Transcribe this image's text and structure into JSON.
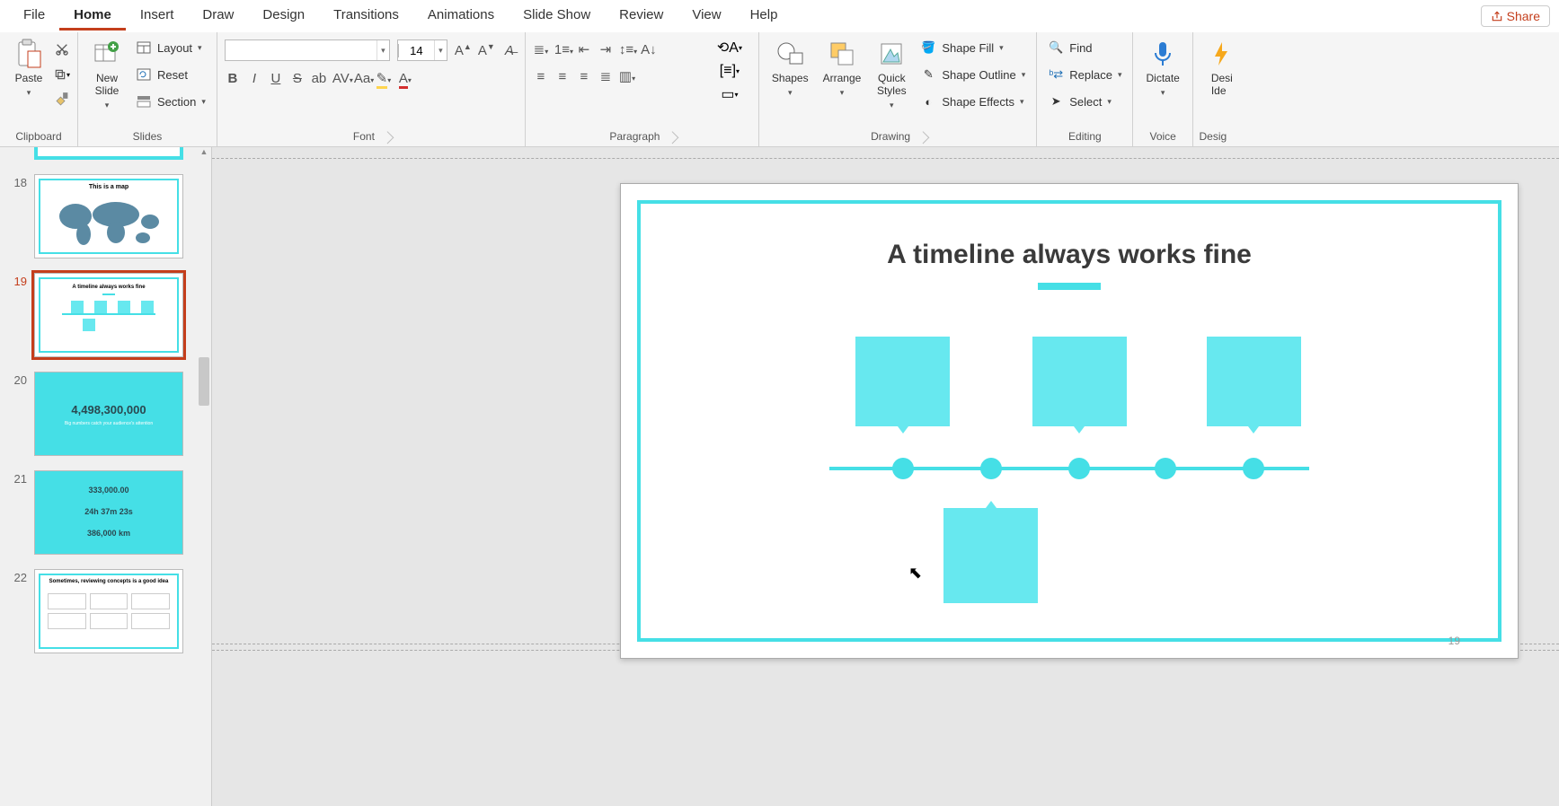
{
  "tabs": [
    "File",
    "Home",
    "Insert",
    "Draw",
    "Design",
    "Transitions",
    "Animations",
    "Slide Show",
    "Review",
    "View",
    "Help"
  ],
  "active_tab": 1,
  "share_label": "Share",
  "ribbon": {
    "clipboard": {
      "paste": "Paste",
      "label": "Clipboard"
    },
    "slides": {
      "new_slide": "New\nSlide",
      "layout": "Layout",
      "reset": "Reset",
      "section": "Section",
      "label": "Slides"
    },
    "font": {
      "name": "",
      "size": "14",
      "label": "Font"
    },
    "paragraph": {
      "label": "Paragraph"
    },
    "drawing": {
      "shapes": "Shapes",
      "arrange": "Arrange",
      "quick": "Quick\nStyles",
      "fill": "Shape Fill",
      "outline": "Shape Outline",
      "effects": "Shape Effects",
      "label": "Drawing"
    },
    "editing": {
      "find": "Find",
      "replace": "Replace",
      "select": "Select",
      "label": "Editing"
    },
    "voice": {
      "dictate": "Dictate",
      "label": "Voice"
    },
    "design_ideas": {
      "btn": "Desi\nIde",
      "label": "Desig"
    }
  },
  "thumbs": [
    {
      "num": "",
      "title": ""
    },
    {
      "num": "18",
      "title": "This is a map"
    },
    {
      "num": "19",
      "title": "A timeline always works fine",
      "selected": true
    },
    {
      "num": "20",
      "big": "4,498,300,000",
      "sub": "Big numbers catch your audience's attention"
    },
    {
      "num": "21",
      "l1": "333,000.00",
      "l2": "24h 37m 23s",
      "l3": "386,000 km"
    },
    {
      "num": "22",
      "title": "Sometimes, reviewing concepts is a good idea"
    }
  ],
  "slide": {
    "title": "A timeline always works fine",
    "page_num": "19"
  }
}
